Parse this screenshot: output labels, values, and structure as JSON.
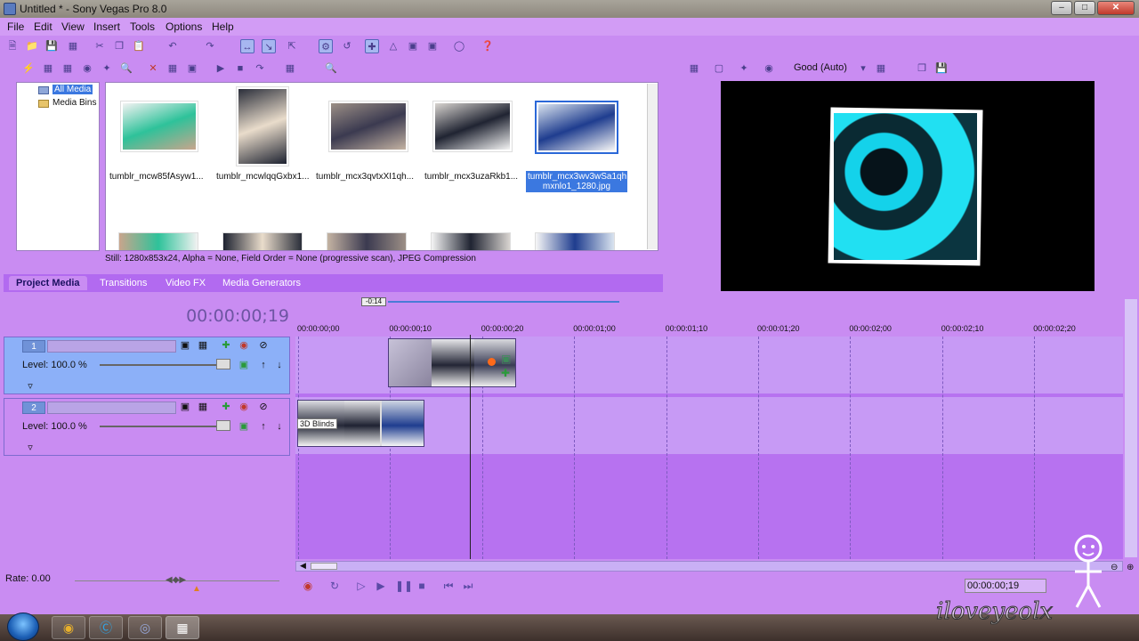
{
  "window": {
    "title": "Untitled * - Sony Vegas Pro 8.0"
  },
  "menu": [
    "File",
    "Edit",
    "View",
    "Insert",
    "Tools",
    "Options",
    "Help"
  ],
  "media_tree": {
    "items": [
      "All Media",
      "Media Bins"
    ]
  },
  "media_files": [
    {
      "name": "tumblr_mcw85fAsyw1...",
      "colors": [
        "#f2f2f2",
        "#2ec29a",
        "#c9a58c"
      ]
    },
    {
      "name": "tumblr_mcwlqqGxbx1...",
      "colors": [
        "#2a2e3a",
        "#e9dccb",
        "#1d2230"
      ]
    },
    {
      "name": "tumblr_mcx3qvtxXI1qh...",
      "colors": [
        "#9c8f86",
        "#3b3a50",
        "#c4b3a3"
      ]
    },
    {
      "name": "tumblr_mcx3uzaRkb1...",
      "colors": [
        "#d8d4d0",
        "#202432",
        "#f4f4f4"
      ]
    },
    {
      "name": "tumblr_mcx3wv3wSa1qh mxnlo1_1280.jpg",
      "colors": [
        "#d9e3ef",
        "#1f3d8f",
        "#f7f7f7"
      ],
      "selected": true
    }
  ],
  "media_status": "Still: 1280x853x24, Alpha = None, Field Order = None (progressive scan), JPEG Compression",
  "tabs": [
    "Project Media",
    "Transitions",
    "Video FX",
    "Media Generators"
  ],
  "preview": {
    "quality": "Good (Auto)"
  },
  "timeline": {
    "timecode": "00:00:00;19",
    "loop_marker": "-0:14",
    "ruler": [
      "00:00:00;00",
      "00:00:00;10",
      "00:00:00;20",
      "00:00:01;00",
      "00:00:01;10",
      "00:00:01;20",
      "00:00:02;00",
      "00:00:02;10",
      "00:00:02;20"
    ],
    "tracks": [
      {
        "number": "1",
        "level": "Level: 100.0 %"
      },
      {
        "number": "2",
        "level": "Level: 100.0 %"
      }
    ],
    "fx_label": "3D Blinds"
  },
  "transport": {
    "rate": "Rate: 0.00",
    "timecode": "00:00:00;19"
  },
  "watermark": "iloveyeolx"
}
